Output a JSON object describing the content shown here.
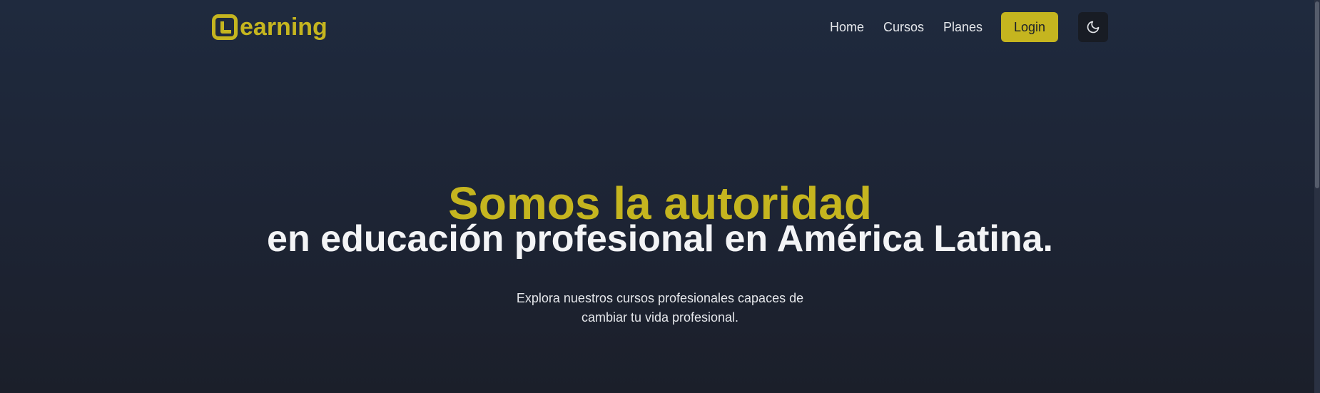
{
  "navbar": {
    "logo": {
      "text": "earning",
      "icon": "letter-l-box-icon"
    },
    "links": [
      {
        "label": "Home"
      },
      {
        "label": "Cursos"
      },
      {
        "label": "Planes"
      }
    ],
    "login_label": "Login",
    "theme_toggle_icon": "moon-icon"
  },
  "hero": {
    "title_highlight": "Somos la autoridad",
    "title_rest": "en educación profesional en América Latina.",
    "subtitle_line_1": "Explora nuestros cursos profesionales capaces de",
    "subtitle_line_2": "cambiar tu vida profesional."
  },
  "colors": {
    "accent": "#c5b51f",
    "background_top": "#1f2a3e",
    "background_bottom": "#1b1f2a",
    "text": "#e5e7eb"
  }
}
